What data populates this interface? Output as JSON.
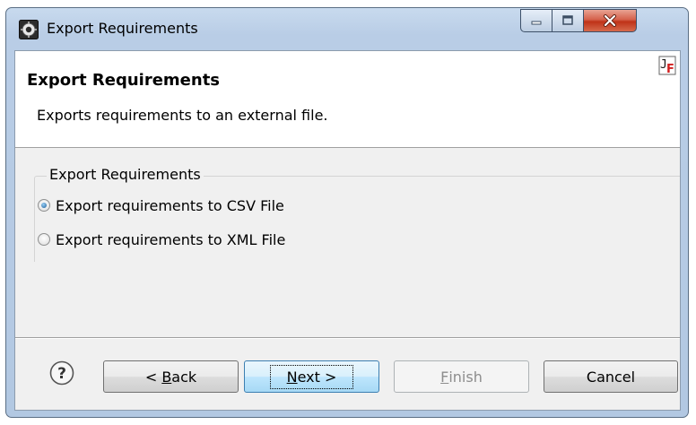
{
  "window": {
    "title": "Export Requirements",
    "controls": {
      "minimize": "minimize",
      "maximize": "maximize",
      "close": "close"
    }
  },
  "header": {
    "title": "Export Requirements",
    "description": "Exports requirements to an external file.",
    "icon": "jf-plugin-icon"
  },
  "group": {
    "label": "Export Requirements",
    "options": [
      {
        "label": "Export requirements to CSV File",
        "checked": true
      },
      {
        "label": "Export requirements to XML File",
        "checked": false
      }
    ]
  },
  "buttons": {
    "back": {
      "prefix": "< ",
      "mnemonic": "B",
      "rest": "ack"
    },
    "next": {
      "mnemonic": "N",
      "rest": "ext >"
    },
    "finish": {
      "mnemonic": "F",
      "rest": "inish",
      "enabled": false
    },
    "cancel": "Cancel"
  },
  "colors": {
    "accent": "#3c7fb1",
    "close_red": "#c7432b"
  }
}
